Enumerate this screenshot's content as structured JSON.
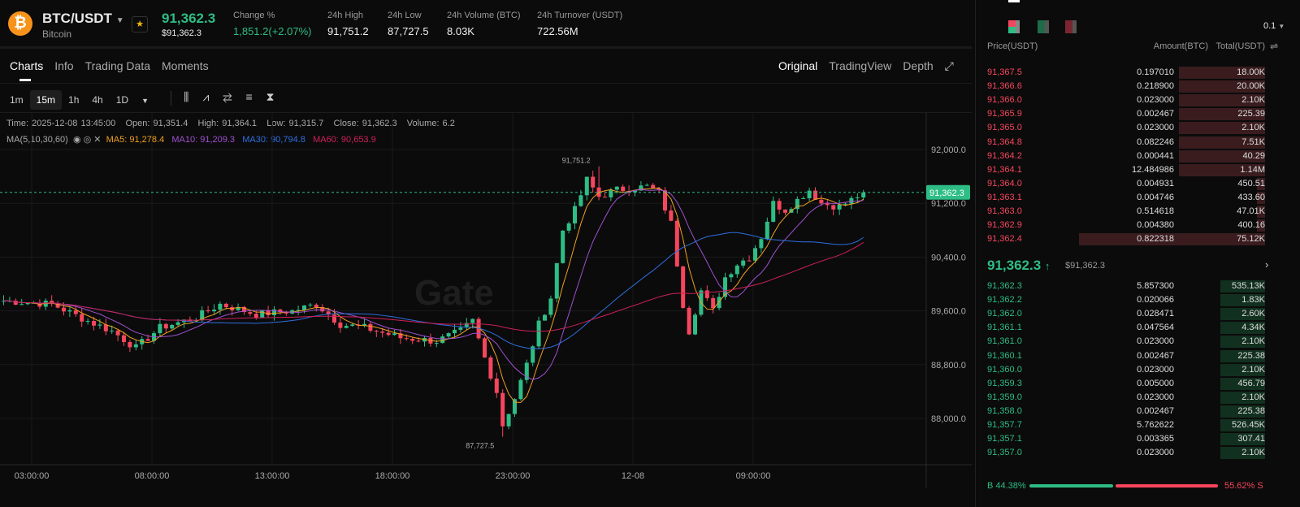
{
  "header": {
    "symbol": "BTC/USDT",
    "name": "Bitcoin",
    "coin_glyph": "₿",
    "price": "91,362.3",
    "price_usd": "$91,362.3",
    "stats": [
      {
        "label": "Change %",
        "value": "1,851.2(+2.07%)",
        "color": "#2ebd85"
      },
      {
        "label": "24h High",
        "value": "91,751.2"
      },
      {
        "label": "24h Low",
        "value": "87,727.5"
      },
      {
        "label": "24h Volume (BTC)",
        "value": "8.03K"
      },
      {
        "label": "24h Turnover (USDT)",
        "value": "722.56M"
      }
    ]
  },
  "tabs": [
    "Charts",
    "Info",
    "Trading Data",
    "Moments"
  ],
  "views": [
    "Original",
    "TradingView",
    "Depth"
  ],
  "timeframes": [
    "1m",
    "15m",
    "1h",
    "4h",
    "1D"
  ],
  "info": {
    "time": "Time: 2025-12-08 13:45:00",
    "open": "Open: 91,351.4",
    "high": "High: 91,364.1",
    "low": "Low: 91,315.7",
    "close": "Close: 91,362.3",
    "volume": "Volume: 6.2",
    "ma_label": "MA(5,10,30,60)",
    "ma5": "MA5: 91,278.4",
    "ma10": "MA10: 91,209.3",
    "ma30": "MA30: 90,794.8",
    "ma60": "MA60: 90,653.9"
  },
  "chart_data": {
    "type": "candlestick",
    "watermark": "Gate",
    "ylim": [
      87400,
      92400
    ],
    "yticks": [
      {
        "v": 92000,
        "label": "92,000.0"
      },
      {
        "v": 91200,
        "label": "91,200.0"
      },
      {
        "v": 90400,
        "label": "90,400.0"
      },
      {
        "v": 89600,
        "label": "89,600.0"
      },
      {
        "v": 88800,
        "label": "88,800.0"
      },
      {
        "v": 88000,
        "label": "88,000.0"
      }
    ],
    "xticks": [
      {
        "i": 5,
        "label": "03:00:00"
      },
      {
        "i": 25,
        "label": "08:00:00"
      },
      {
        "i": 45,
        "label": "13:00:00"
      },
      {
        "i": 65,
        "label": "18:00:00"
      },
      {
        "i": 85,
        "label": "23:00:00"
      },
      {
        "i": 105,
        "label": "12-08"
      },
      {
        "i": 125,
        "label": "09:00:00"
      }
    ],
    "keypoints": [
      [
        0,
        89750
      ],
      [
        8,
        89700
      ],
      [
        14,
        89450
      ],
      [
        18,
        89300
      ],
      [
        22,
        89050
      ],
      [
        26,
        89350
      ],
      [
        32,
        89500
      ],
      [
        36,
        89700
      ],
      [
        42,
        89550
      ],
      [
        48,
        89600
      ],
      [
        52,
        89700
      ],
      [
        56,
        89400
      ],
      [
        60,
        89350
      ],
      [
        66,
        89200
      ],
      [
        72,
        89150
      ],
      [
        76,
        89300
      ],
      [
        78,
        89450
      ],
      [
        80,
        88900
      ],
      [
        82,
        88400
      ],
      [
        83,
        87900
      ],
      [
        85,
        88300
      ],
      [
        87,
        88800
      ],
      [
        89,
        89400
      ],
      [
        91,
        89800
      ],
      [
        93,
        90800
      ],
      [
        95,
        91100
      ],
      [
        97,
        91550
      ],
      [
        99,
        91300
      ],
      [
        102,
        91400
      ],
      [
        107,
        91450
      ],
      [
        109,
        91350
      ],
      [
        111,
        90900
      ],
      [
        113,
        89700
      ],
      [
        114,
        89300
      ],
      [
        116,
        89900
      ],
      [
        118,
        89600
      ],
      [
        120,
        90100
      ],
      [
        122,
        90300
      ],
      [
        124,
        90400
      ],
      [
        126,
        90700
      ],
      [
        128,
        91200
      ],
      [
        130,
        91100
      ],
      [
        132,
        91250
      ],
      [
        134,
        91400
      ],
      [
        136,
        91200
      ],
      [
        139,
        91150
      ],
      [
        141,
        91250
      ],
      [
        143,
        91362.3
      ]
    ],
    "high_label": "91,751.2",
    "high_index": 99,
    "low_label": "87,727.5",
    "low_index": 83,
    "last_price": "91,362.3",
    "last": 91362.3,
    "colors": {
      "up": "#2ebd85",
      "down": "#f6465d",
      "ma5": "#f0a020",
      "ma10": "#a050d0",
      "ma30": "#2f6fe0",
      "ma60": "#d0205a"
    }
  },
  "orderbook": {
    "precision": "0.1",
    "headers": [
      "Price(USDT)",
      "Amount(BTC)",
      "Total(USDT)"
    ],
    "asks": [
      [
        "91,367.5",
        "0.197010",
        "18.00K",
        0.31
      ],
      [
        "91,366.6",
        "0.218900",
        "20.00K",
        0.31
      ],
      [
        "91,366.0",
        "0.023000",
        "2.10K",
        0.31
      ],
      [
        "91,365.9",
        "0.002467",
        "225.39",
        0.31
      ],
      [
        "91,365.0",
        "0.023000",
        "2.10K",
        0.31
      ],
      [
        "91,364.8",
        "0.082246",
        "7.51K",
        0.31
      ],
      [
        "91,364.2",
        "0.000441",
        "40.29",
        0.31
      ],
      [
        "91,364.1",
        "12.484986",
        "1.14M",
        0.31
      ],
      [
        "91,364.0",
        "0.004931",
        "450.51",
        0.03
      ],
      [
        "91,363.1",
        "0.004746",
        "433.60",
        0.03
      ],
      [
        "91,363.0",
        "0.514618",
        "47.01K",
        0.03
      ],
      [
        "91,362.9",
        "0.004380",
        "400.16",
        0.03
      ],
      [
        "91,362.4",
        "0.822318",
        "75.12K",
        0.67
      ]
    ],
    "mid_price": "91,362.3",
    "mid_usd": "$91,362.3",
    "bids": [
      [
        "91,362.3",
        "5.857300",
        "535.13K",
        0.16
      ],
      [
        "91,362.2",
        "0.020066",
        "1.83K",
        0.16
      ],
      [
        "91,362.0",
        "0.028471",
        "2.60K",
        0.16
      ],
      [
        "91,361.1",
        "0.047564",
        "4.34K",
        0.16
      ],
      [
        "91,361.0",
        "0.023000",
        "2.10K",
        0.16
      ],
      [
        "91,360.1",
        "0.002467",
        "225.38",
        0.16
      ],
      [
        "91,360.0",
        "0.023000",
        "2.10K",
        0.16
      ],
      [
        "91,359.3",
        "0.005000",
        "456.79",
        0.16
      ],
      [
        "91,359.0",
        "0.023000",
        "2.10K",
        0.16
      ],
      [
        "91,358.0",
        "0.002467",
        "225.38",
        0.16
      ],
      [
        "91,357.7",
        "5.762622",
        "526.45K",
        0.16
      ],
      [
        "91,357.1",
        "0.003365",
        "307.41",
        0.16
      ],
      [
        "91,357.0",
        "0.023000",
        "2.10K",
        0.16
      ]
    ],
    "buy_ratio": "B 44.38%",
    "sell_ratio": "55.62% S",
    "buy_pct": 44.38
  }
}
